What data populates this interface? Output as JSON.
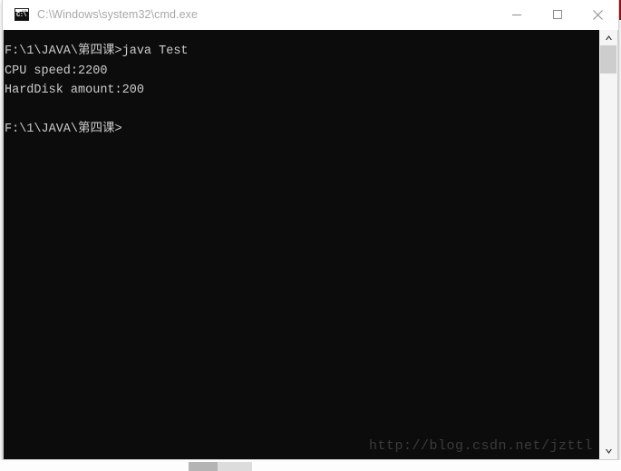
{
  "window": {
    "title": "C:\\Windows\\system32\\cmd.exe",
    "icon_name": "cmd-console-icon",
    "icon_glyph": "C:\\",
    "controls": {
      "minimize_label": "Minimize",
      "maximize_label": "Maximize",
      "close_label": "Close"
    },
    "colors": {
      "titlebar_background": "#ffffff",
      "titlebar_text": "#a8a8a8",
      "console_background": "#0c0c0c",
      "console_text": "#cccccc",
      "control_glyph": "#8c8c8c",
      "scrollbar_track": "#f5f5f5",
      "scrollbar_thumb": "#cdcdcd",
      "watermark_text": "#3b3b3b",
      "background_window_accent": "#8b1a1a"
    }
  },
  "console": {
    "lines": [
      "F:\\1\\JAVA\\第四课>java Test",
      "CPU speed:2200",
      "HardDisk amount:200",
      "",
      "F:\\1\\JAVA\\第四课>"
    ],
    "text": "F:\\1\\JAVA\\第四课>java Test\nCPU speed:2200\nHardDisk amount:200\n\nF:\\1\\JAVA\\第四课>",
    "prompt": "F:\\1\\JAVA\\第四课>",
    "command": "java Test",
    "output": [
      "CPU speed:2200",
      "HardDisk amount:200"
    ],
    "watermark": "http://blog.csdn.net/jzttl"
  },
  "scrollbar": {
    "up_arrow_name": "scroll-up-arrow",
    "down_arrow_name": "scroll-down-arrow",
    "thumb_name": "scrollbar-thumb"
  }
}
